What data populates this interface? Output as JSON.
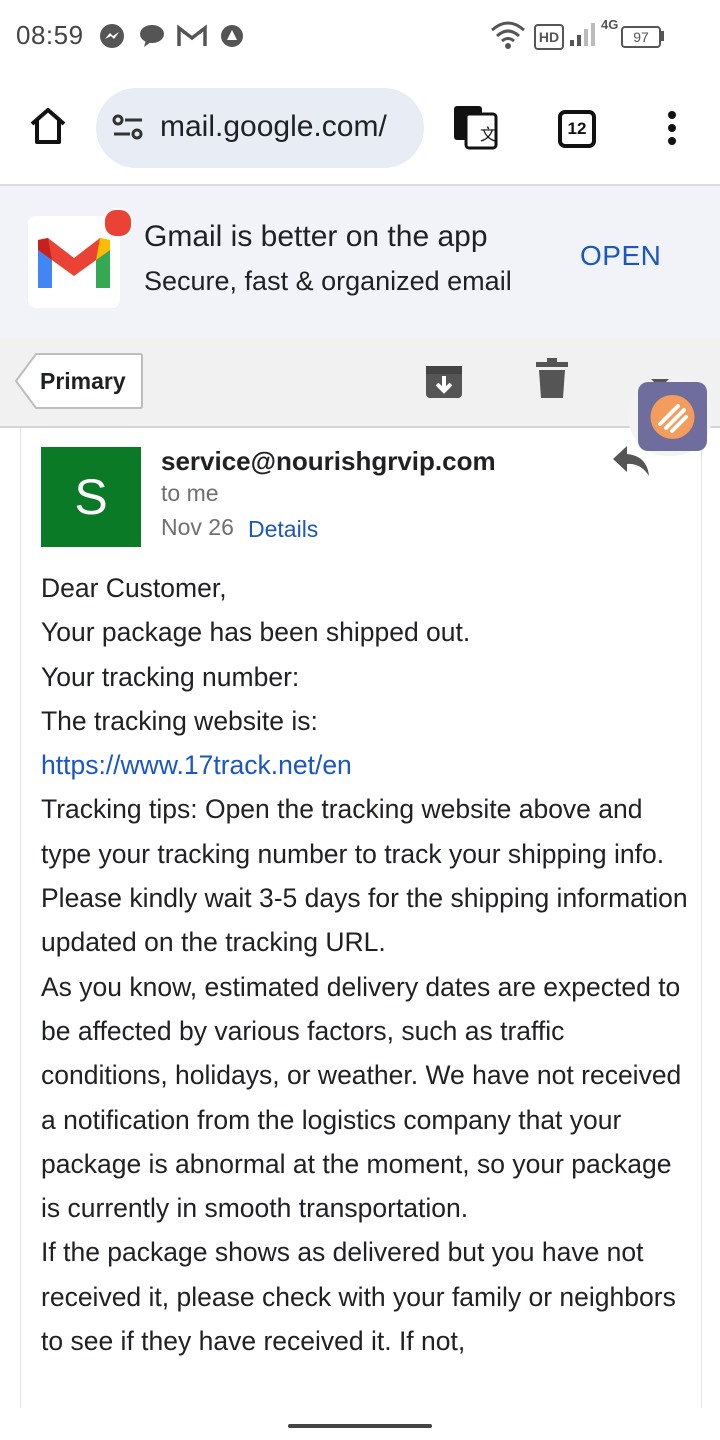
{
  "status_bar": {
    "time": "08:59",
    "network": "4G",
    "battery": "97",
    "hd_label": "HD",
    "icons": [
      "messenger-icon",
      "chat-icon",
      "gmail-icon",
      "vpn-icon",
      "wifi-icon",
      "signal-icon",
      "battery-icon"
    ]
  },
  "browser": {
    "url": "mail.google.com/",
    "tab_count": "12",
    "icons": [
      "home-icon",
      "site-settings-icon",
      "translate-icon",
      "tabs-icon",
      "more-menu-icon"
    ]
  },
  "app_banner": {
    "title": "Gmail is better on the app",
    "subtitle": "Secure, fast & organized email",
    "open_label": "OPEN"
  },
  "action_bar": {
    "back_label": "Primary",
    "icons": [
      "archive-icon",
      "delete-icon"
    ]
  },
  "email": {
    "avatar_letter": "S",
    "avatar_color": "#0b7a26",
    "sender": "service@nourishgrvip.com",
    "recipient": "to me",
    "date": "Nov 26",
    "details_label": "Details",
    "body": [
      "Dear Customer,",
      "Your package has been shipped out.",
      "Your tracking number:",
      "The tracking website is:",
      "https://www.17track.net/en",
      "Tracking tips: Open the tracking website above and type your tracking number to track your shipping info.",
      "Please kindly wait 3-5 days for the shipping information updated on the tracking URL.",
      "As you know, estimated delivery dates are expected to be affected by various factors, such as traffic conditions, holidays, or weather. We have not received a notification from the logistics company that your package is abnormal at the moment, so your package is currently in smooth transportation.",
      "If the package shows as delivered but you have not received it, please check with your family or neighbors to see if they have received it. If not,"
    ]
  },
  "colors": {
    "link": "#1a56c4",
    "banner_bg": "#f1f3f9",
    "omnibox_bg": "#e8edf5"
  }
}
